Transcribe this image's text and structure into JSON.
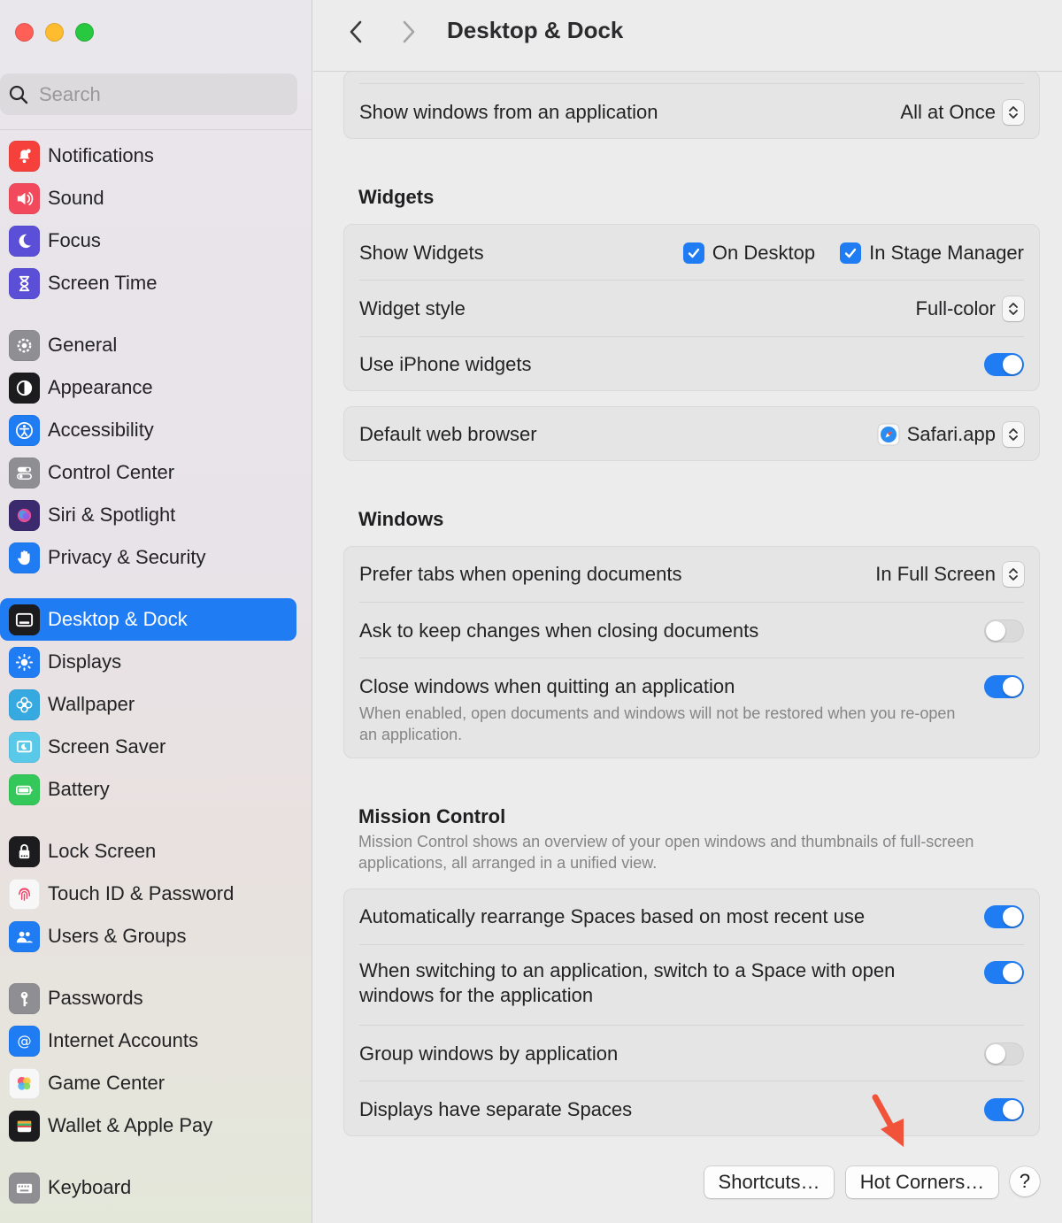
{
  "window": {
    "title": "Desktop & Dock"
  },
  "search": {
    "placeholder": "Search"
  },
  "sidebar": {
    "groups": [
      [
        {
          "label": "Notifications",
          "icon": "notifications-icon",
          "color": "#f5403c"
        },
        {
          "label": "Sound",
          "icon": "speaker-icon",
          "color": "#f24a5c"
        },
        {
          "label": "Focus",
          "icon": "moon-icon",
          "color": "#5a4fd6"
        },
        {
          "label": "Screen Time",
          "icon": "hourglass-icon",
          "color": "#5a4fd6"
        }
      ],
      [
        {
          "label": "General",
          "icon": "gear-icon",
          "color": "#8e8e93"
        },
        {
          "label": "Appearance",
          "icon": "appearance-icon",
          "color": "#1c1c1e"
        },
        {
          "label": "Accessibility",
          "icon": "accessibility-icon",
          "color": "#1f7cf3"
        },
        {
          "label": "Control Center",
          "icon": "toggles-icon",
          "color": "#8e8e93"
        },
        {
          "label": "Siri & Spotlight",
          "icon": "siri-icon",
          "color": "#3b2a6e"
        },
        {
          "label": "Privacy & Security",
          "icon": "hand-icon",
          "color": "#1f7cf3"
        }
      ],
      [
        {
          "label": "Desktop & Dock",
          "icon": "dock-icon",
          "color": "#1c1c1e",
          "active": true
        },
        {
          "label": "Displays",
          "icon": "sun-icon",
          "color": "#1f7cf3"
        },
        {
          "label": "Wallpaper",
          "icon": "flower-icon",
          "color": "#36a9e0"
        },
        {
          "label": "Screen Saver",
          "icon": "screensaver-icon",
          "color": "#5ac8e8"
        },
        {
          "label": "Battery",
          "icon": "battery-icon",
          "color": "#34c759"
        }
      ],
      [
        {
          "label": "Lock Screen",
          "icon": "lock-icon",
          "color": "#1c1c1e"
        },
        {
          "label": "Touch ID & Password",
          "icon": "fingerprint-icon",
          "color": "#f7f7f7"
        },
        {
          "label": "Users & Groups",
          "icon": "users-icon",
          "color": "#1f7cf3"
        }
      ],
      [
        {
          "label": "Passwords",
          "icon": "key-icon",
          "color": "#8e8e93"
        },
        {
          "label": "Internet Accounts",
          "icon": "at-icon",
          "color": "#1f7cf3"
        },
        {
          "label": "Game Center",
          "icon": "game-center-icon",
          "color": "#f7f7f7"
        },
        {
          "label": "Wallet & Apple Pay",
          "icon": "wallet-icon",
          "color": "#1c1c1e"
        }
      ],
      [
        {
          "label": "Keyboard",
          "icon": "keyboard-icon",
          "color": "#8e8e93"
        }
      ]
    ]
  },
  "main": {
    "show_windows": {
      "label": "Show windows from an application",
      "value": "All at Once"
    },
    "widgets": {
      "title": "Widgets",
      "show_widgets_label": "Show Widgets",
      "on_desktop_label": "On Desktop",
      "on_desktop_checked": true,
      "stage_manager_label": "In Stage Manager",
      "stage_manager_checked": true,
      "style_label": "Widget style",
      "style_value": "Full-color",
      "iphone_label": "Use iPhone widgets",
      "iphone_on": true
    },
    "browser": {
      "label": "Default web browser",
      "value": "Safari.app"
    },
    "windows": {
      "title": "Windows",
      "prefer_tabs_label": "Prefer tabs when opening documents",
      "prefer_tabs_value": "In Full Screen",
      "ask_keep_label": "Ask to keep changes when closing documents",
      "ask_keep_on": false,
      "close_windows_label": "Close windows when quitting an application",
      "close_windows_desc": "When enabled, open documents and windows will not be restored when you re-open an application.",
      "close_windows_on": true
    },
    "mission_control": {
      "title": "Mission Control",
      "desc": "Mission Control shows an overview of your open windows and thumbnails of full-screen applications, all arranged in a unified view.",
      "auto_rearrange_label": "Automatically rearrange Spaces based on most recent use",
      "auto_rearrange_on": true,
      "switch_space_label": "When switching to an application, switch to a Space with open windows for the application",
      "switch_space_on": true,
      "group_windows_label": "Group windows by application",
      "group_windows_on": false,
      "separate_spaces_label": "Displays have separate Spaces",
      "separate_spaces_on": true
    },
    "buttons": {
      "shortcuts": "Shortcuts…",
      "hot_corners": "Hot Corners…",
      "help": "?"
    }
  },
  "colors": {
    "accent": "#1f7cf3",
    "annotation_arrow": "#f0533a"
  }
}
